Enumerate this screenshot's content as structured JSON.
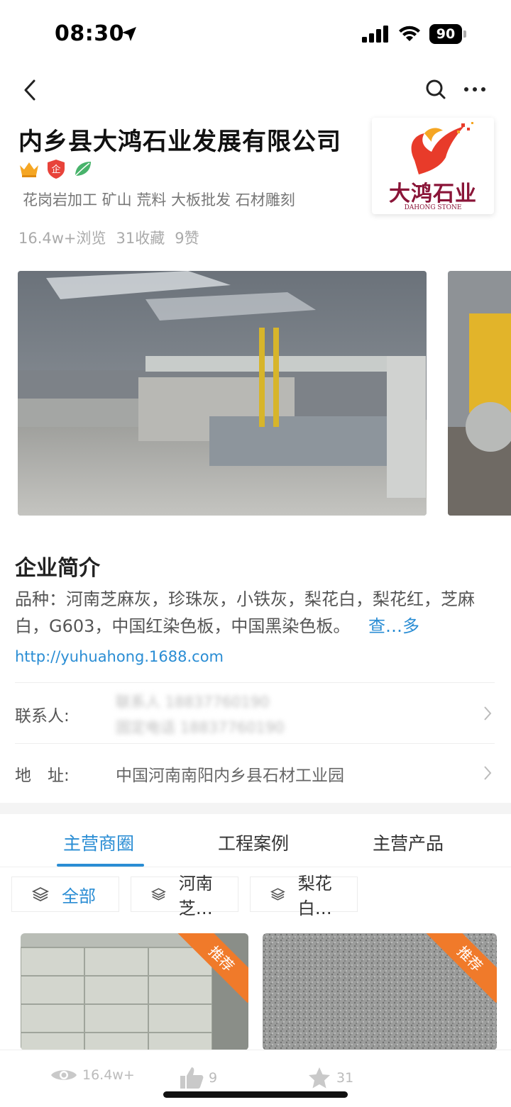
{
  "status_bar": {
    "time": "08:30",
    "battery": "90"
  },
  "company": {
    "name": "内乡县大鸿石业发展有限公司",
    "tags": "花岗岩加工 矿山 荒料 大板批发 石材雕刻",
    "stats": {
      "views": "16.4w+浏览",
      "favorites": "31收藏",
      "likes": "9赞"
    },
    "logo": {
      "title": "大鸿石业",
      "subtitle": "DAHONG STONE"
    }
  },
  "intro": {
    "title": "企业简介",
    "text": "品种：河南芝麻灰，珍珠灰，小铁灰，梨花白，梨花红，芝麻白，G603，中国红染色板，中国黑染色板。",
    "more": "查…多",
    "website": "http://yuhuahong.1688.com"
  },
  "contact": {
    "label": "联系人:",
    "line1": "联系人 18837760190",
    "line2": "固定电话 18837760190"
  },
  "address": {
    "label": "地　址:",
    "value": "中国河南南阳内乡县石材工业园"
  },
  "tabs": [
    "主营商圈",
    "工程案例",
    "主营产品"
  ],
  "chips": [
    "全部",
    "河南芝…",
    "梨花白…"
  ],
  "cards": [
    {
      "badge": "推荐"
    },
    {
      "badge": "推荐"
    }
  ],
  "bottom_bar": {
    "views": "16.4w+",
    "likes": "9",
    "favorites": "31"
  },
  "colors": {
    "accent": "#2a8dd4",
    "ribbon": "#f07a2a",
    "logo": "#8a1538"
  }
}
